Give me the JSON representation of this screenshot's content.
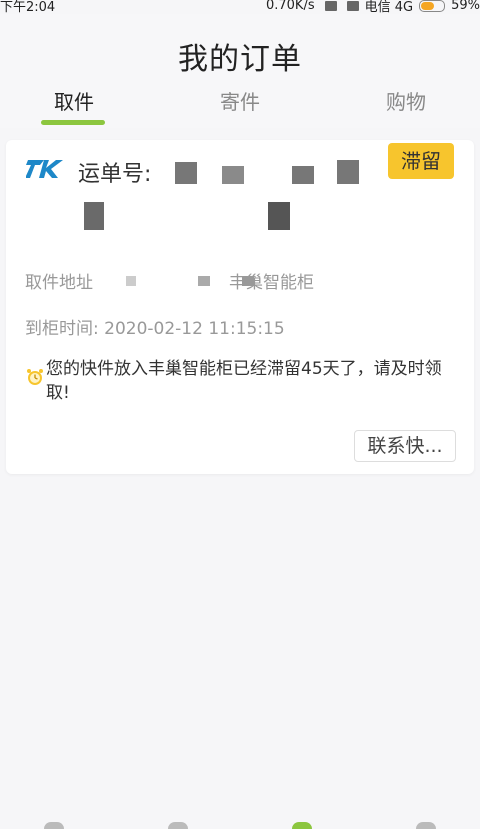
{
  "status_bar": {
    "time": "下午2:04",
    "network_speed": "0.70K/s",
    "carrier": "电信 4G",
    "battery": "59%",
    "battery_level": 0.59
  },
  "header": {
    "title": "我的订单"
  },
  "tabs": [
    {
      "label": "取件",
      "active": true
    },
    {
      "label": "寄件",
      "active": false
    },
    {
      "label": "购物",
      "active": false
    }
  ],
  "order": {
    "waybill_label": "运单号:",
    "status_badge": "滞留",
    "pickup_address_prefix": "取件地址",
    "pickup_address_suffix": "丰巢智能柜",
    "arrival_time": "到柜时间: 2020-02-12 11:15:15",
    "notice": "您的快件放入丰巢智能柜已经滞留45天了，请及时领取!",
    "contact_button": "联系快..."
  },
  "colors": {
    "accent_green": "#8cc63f",
    "badge_yellow": "#f7c52d",
    "logo_blue": "#1e88c8"
  }
}
